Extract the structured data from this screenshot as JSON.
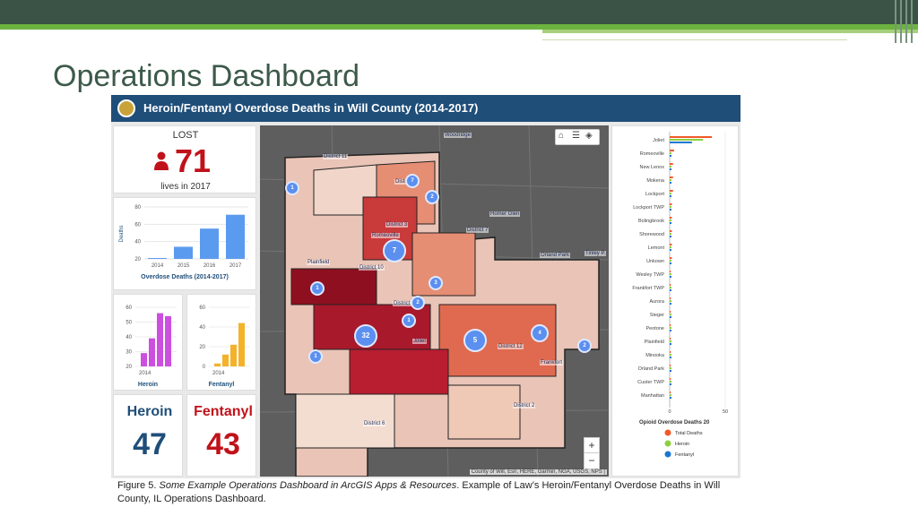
{
  "slide": {
    "title": "Operations Dashboard",
    "caption_prefix": "Figure 5.",
    "caption_italic": "Some Example Operations Dashboard in ArcGIS Apps & Resources",
    "caption_rest": ". Example of Law’s Heroin/Fentanyl Overdose Deaths in Will County, IL Operations Dashboard."
  },
  "dashboard": {
    "title": "Heroin/Fentanyl Overdose Deaths in Will County (2014-2017)",
    "lost_label": "LOST",
    "lost_value": "71",
    "lost_sub": "lives in 2017",
    "colors": {
      "header": "#1f4e79",
      "red": "#c0121a",
      "blue": "#1f4e79",
      "heroin_bar": "#cc4fe0",
      "fentanyl_bar": "#f3b22a",
      "overdose_bar": "#5b9bef"
    },
    "overdose_chart": {
      "title": "Overdose Deaths (2014-2017)",
      "ylabel": "Deaths",
      "y_ticks": [
        "80",
        "60",
        "40",
        "20"
      ],
      "categories": [
        "2014",
        "2015",
        "2016",
        "2017"
      ],
      "values": [
        21,
        34,
        55,
        71
      ]
    },
    "heroin_chart": {
      "label": "Heroin",
      "y_ticks": [
        "60",
        "50",
        "40",
        "30",
        "20"
      ],
      "x_label": "2014",
      "values": [
        29,
        39,
        56,
        54
      ]
    },
    "fentanyl_chart": {
      "label": "Fentanyl",
      "y_ticks": [
        "60",
        "40",
        "20",
        "0"
      ],
      "x_label": "2014",
      "values": [
        3,
        12,
        22,
        44
      ]
    },
    "heroin_total_label": "Heroin",
    "heroin_total": "47",
    "fentanyl_total_label": "Fentanyl",
    "fentanyl_total": "43",
    "map": {
      "labels": [
        "District 11",
        "District 3",
        "District 9",
        "District 7",
        "District 10",
        "District 1",
        "District 12",
        "District 6",
        "District 2",
        "Joliet",
        "Romeoville",
        "Orland Park",
        "Homer Glen",
        "Plainfield",
        "Tinley P.",
        "Woodridge",
        "Frankfort"
      ],
      "clusters": [
        "1",
        "7",
        "2",
        "7",
        "1",
        "3",
        "1",
        "2",
        "32",
        "5",
        "4",
        "2",
        "1",
        "1",
        "1"
      ],
      "attribution": "County of Will, Esri, HERE, Garmin, NGA, USGS, NPS |"
    },
    "municipalities": {
      "legend_title": "Opioid Overdose Deaths 20",
      "axis_ticks": [
        "0",
        "50"
      ],
      "items": [
        "Joliet",
        "Romeoville",
        "New Lenox",
        "Mokena",
        "Lockport",
        "Lockport TWP",
        "Bolingbrook",
        "Shorewood",
        "Lemont",
        "Unkown",
        "Wesley TWP",
        "Frankfort TWP",
        "Aurora",
        "Steger",
        "Peotone",
        "Plainfield",
        "Minooka",
        "Orland Park",
        "Custer TWP",
        "Manhattan"
      ],
      "total_values": [
        38,
        4,
        3,
        3,
        3,
        2,
        2,
        2,
        2,
        2,
        1,
        1,
        1,
        1,
        1,
        1,
        1,
        1,
        1,
        1
      ],
      "legend": [
        "Total Deaths",
        "Heroin",
        "Fentanyl"
      ],
      "legend_colors": [
        "#f05a28",
        "#8ccf3f",
        "#1976d2"
      ]
    }
  }
}
